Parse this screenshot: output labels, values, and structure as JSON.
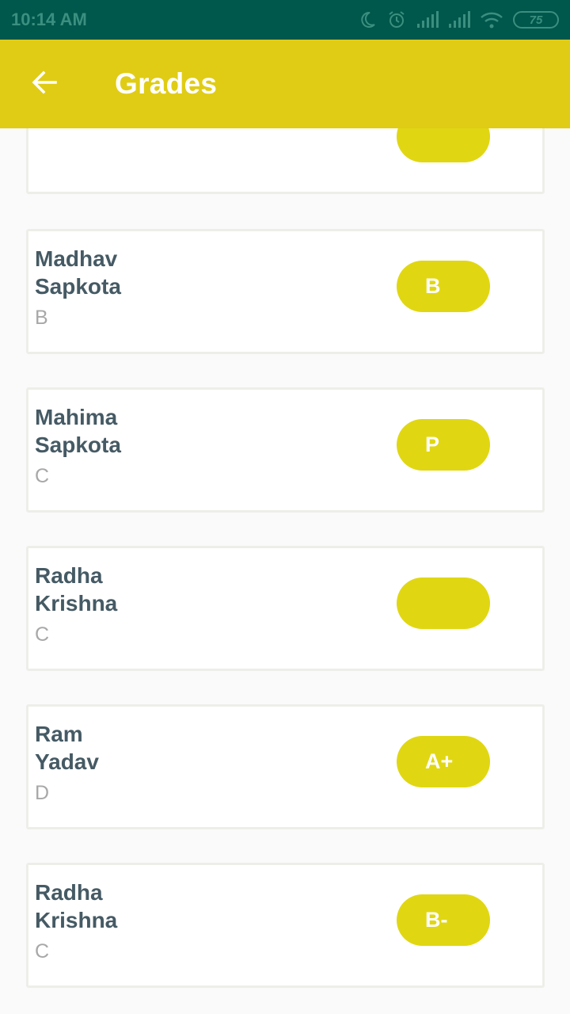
{
  "status_bar": {
    "time": "10:14 AM",
    "battery": "75"
  },
  "app_bar": {
    "title": "Grades"
  },
  "cards": [
    {
      "name_first": "",
      "name_last": "",
      "class": "",
      "grade": ""
    },
    {
      "name_first": "Madhav",
      "name_last": "Sapkota",
      "class": "B",
      "grade": "B"
    },
    {
      "name_first": "Mahima",
      "name_last": "Sapkota",
      "class": "C",
      "grade": "P"
    },
    {
      "name_first": "Radha",
      "name_last": "Krishna",
      "class": "C",
      "grade": ""
    },
    {
      "name_first": "Ram",
      "name_last": "Yadav",
      "class": "D",
      "grade": "A+"
    },
    {
      "name_first": "Radha",
      "name_last": "Krishna",
      "class": "C",
      "grade": "B-"
    }
  ],
  "colors": {
    "status_bar": "#00574b",
    "app_bar": "#e0cc14",
    "pill": "#e0d712",
    "name_text": "#455a64",
    "class_text": "#a8a8a8"
  }
}
